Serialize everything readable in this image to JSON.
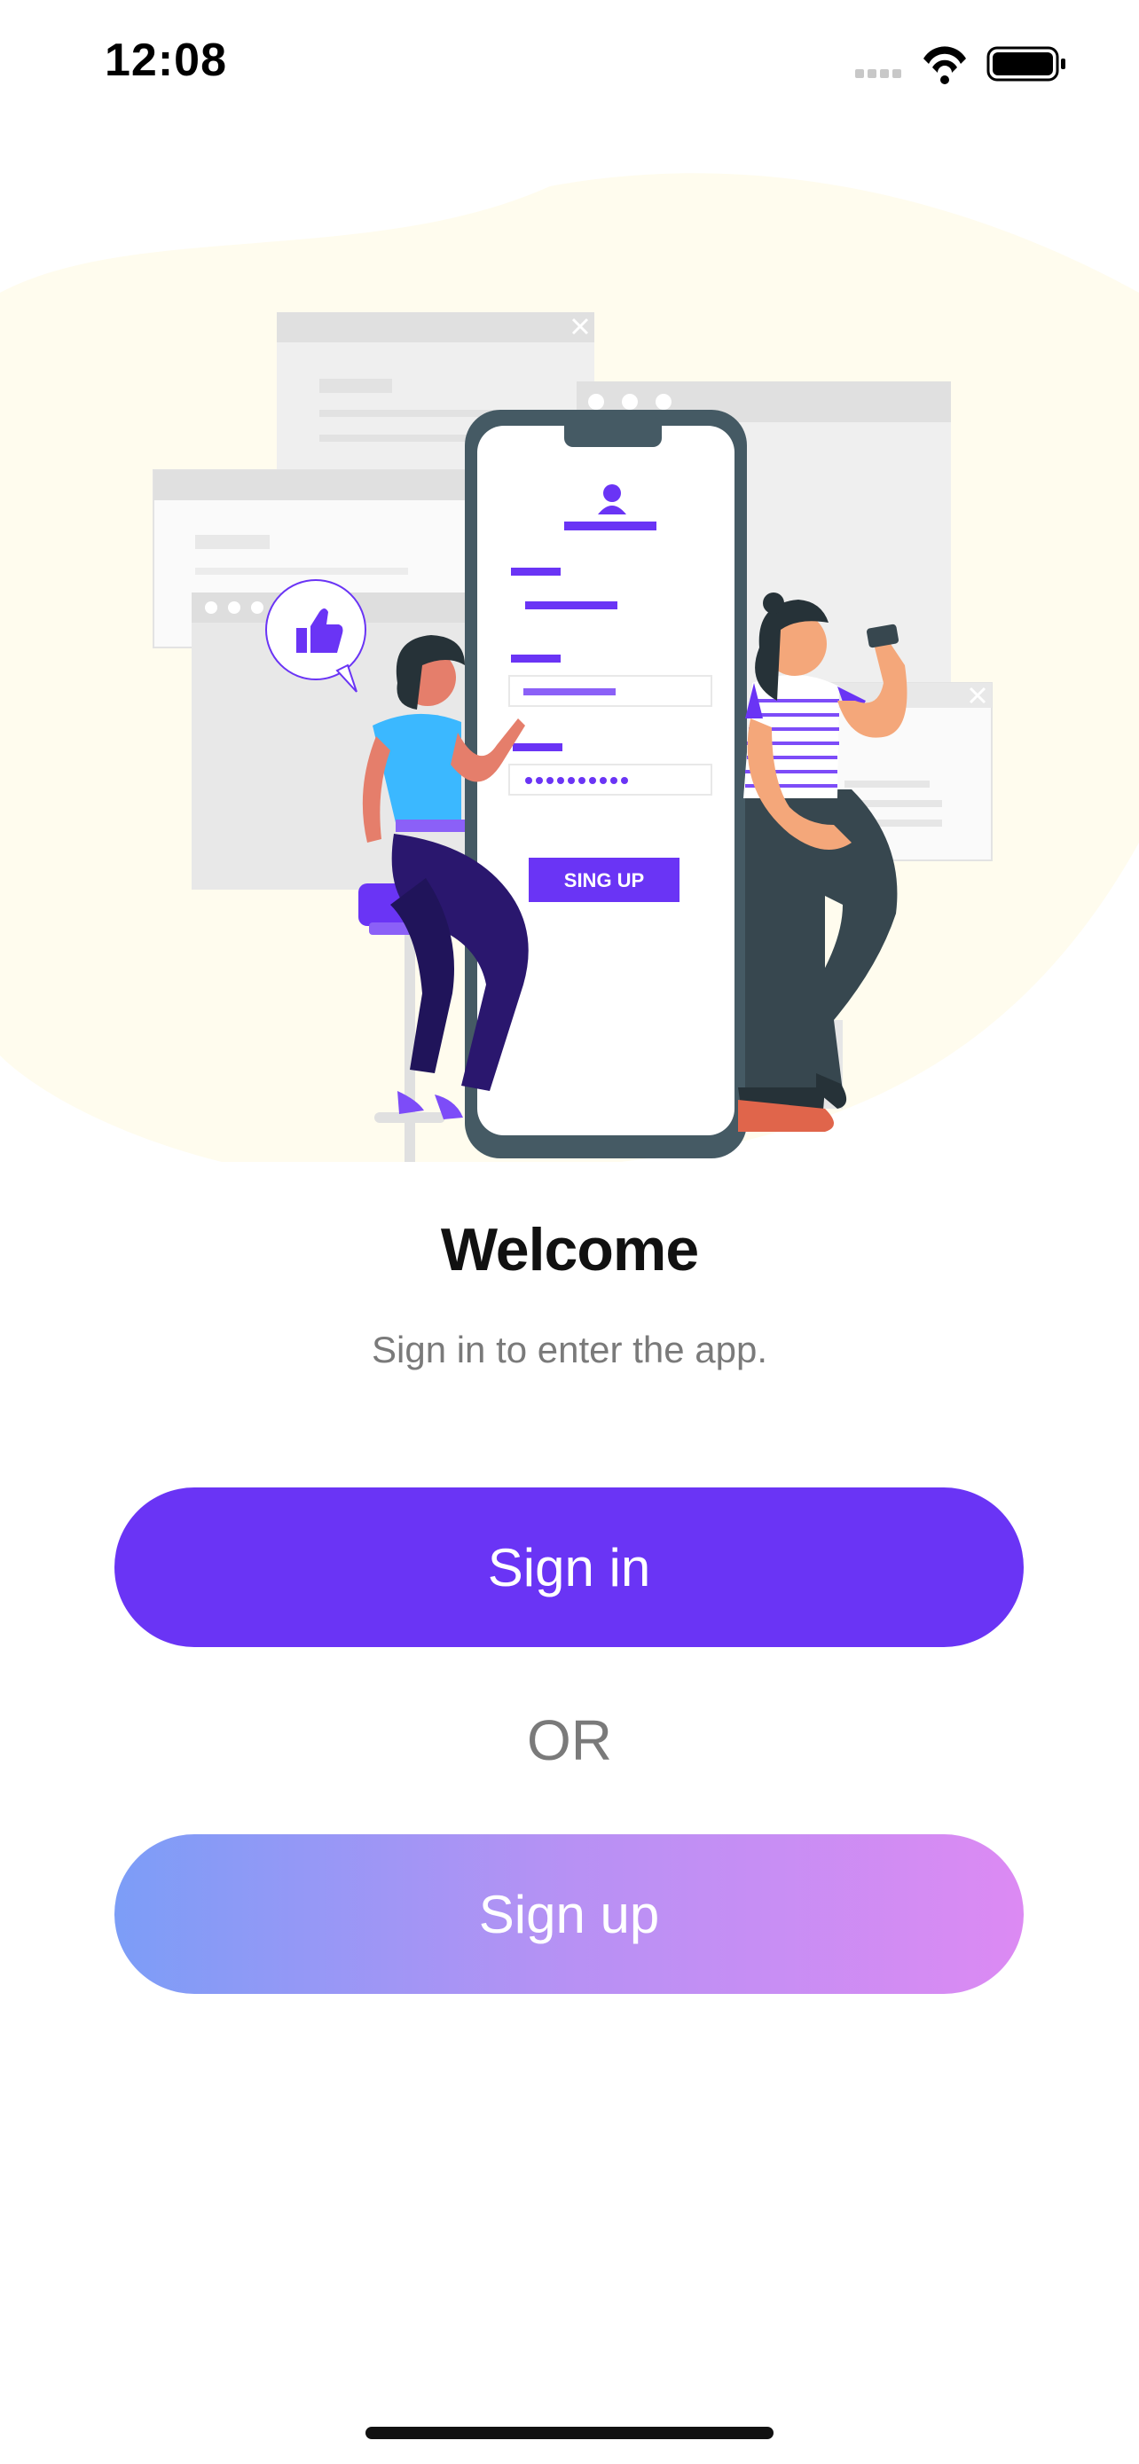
{
  "status_bar": {
    "time": "12:08",
    "icons": [
      "cellular-signal-icon",
      "wifi-icon",
      "battery-icon"
    ]
  },
  "hero": {
    "illustration": "sign-up-illustration",
    "phone_button_label": "SING UP",
    "colors": {
      "blob": "#fffcee",
      "accent": "#6a34f5",
      "phone_frame": "#455a64",
      "shirt_blue": "#3bb8ff"
    }
  },
  "welcome": {
    "title": "Welcome",
    "subtitle": "Sign in to enter the app."
  },
  "actions": {
    "sign_in_label": "Sign in",
    "or_label": "OR",
    "sign_up_label": "Sign up"
  },
  "colors": {
    "primary": "#6a34f5",
    "gradient_start": "#7c9df7",
    "gradient_end": "#dc8af3",
    "muted_text": "#7a7a7a"
  }
}
